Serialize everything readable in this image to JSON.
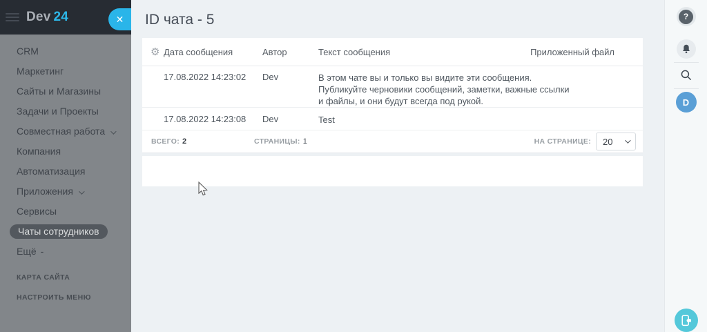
{
  "app": {
    "logo_text": "Dev",
    "logo_accent": "24",
    "collapse_glyph": "✕"
  },
  "sidebar": {
    "items": [
      {
        "label": "CRM"
      },
      {
        "label": "Маркетинг"
      },
      {
        "label": "Сайты и Магазины"
      },
      {
        "label": "Задачи и Проекты"
      },
      {
        "label": "Совместная работа",
        "chevron": true
      },
      {
        "label": "Компания"
      },
      {
        "label": "Автоматизация"
      },
      {
        "label": "Приложения",
        "chevron": true
      },
      {
        "label": "Сервисы"
      },
      {
        "label": "Чаты сотрудников",
        "active": true
      },
      {
        "label": "Ещё",
        "suffix": "-"
      }
    ],
    "footer_links": [
      "КАРТА САЙТА",
      "НАСТРОИТЬ МЕНЮ"
    ]
  },
  "page": {
    "title": "ID чата - 5"
  },
  "table": {
    "gear_glyph": "⚙",
    "columns": [
      "Дата сообщения",
      "Автор",
      "Текст сообщения",
      "Приложенный файл"
    ],
    "rows": [
      {
        "date": "17.08.2022 14:23:02",
        "author": "Dev",
        "text_lines": [
          "В этом чате вы и только вы видите эти сообщения.",
          "Публикуйте черновики сообщений, заметки, важные ссылки",
          "и файлы, и они будут всегда под рукой."
        ],
        "file": ""
      },
      {
        "date": "17.08.2022 14:23:08",
        "author": "Dev",
        "text_lines": [
          "Test"
        ],
        "file": ""
      }
    ],
    "footer": {
      "total_label": "ВСЕГО:",
      "total_value": "2",
      "pages_label": "СТРАНИЦЫ:",
      "pages_value": "1",
      "per_page_label": "НА СТРАНИЦЕ:",
      "per_page_value": "20"
    }
  },
  "right_rail": {
    "help_glyph": "?",
    "avatar_initial": "D"
  },
  "colors": {
    "topbar_bg": "#272c33",
    "sidebar_bg": "#82868a",
    "accent_cyan": "#2ab5e9",
    "active_pill_bg": "#53585e",
    "content_bg": "#edf1f4",
    "avatar_blue": "#5a9fd6",
    "mobile_btn_cyan": "#54c8da"
  }
}
